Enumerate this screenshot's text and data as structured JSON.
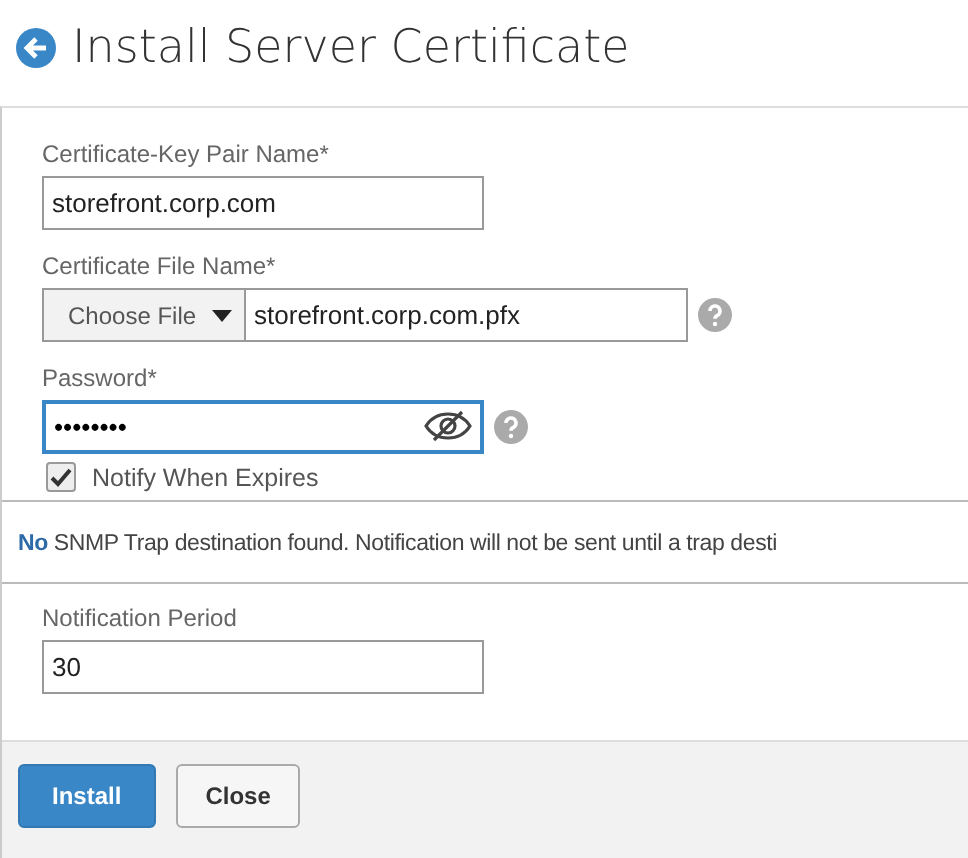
{
  "title": "Install Server Certificate",
  "fields": [
    {
      "kind": "text",
      "label": "Certificate-Key Pair Name*",
      "value": "storefront.corp.com"
    },
    {
      "kind": "file",
      "label": "Certificate File Name*",
      "button": "Choose File",
      "value": "storefront.corp.com.pfx"
    },
    {
      "kind": "password",
      "label": "Password*",
      "value": "••••••••",
      "focused": true
    }
  ],
  "notify": {
    "label": "Notify When Expires",
    "checked": true
  },
  "message": "**No** SNMP Trap destination found. Notification will not be sent until a trap desti",
  "period": {
    "label": "Notification Period",
    "value": "30"
  },
  "buttons": [
    {
      "label": "Install",
      "kind": "primary"
    },
    {
      "label": "Close",
      "kind": "secondary"
    }
  ]
}
